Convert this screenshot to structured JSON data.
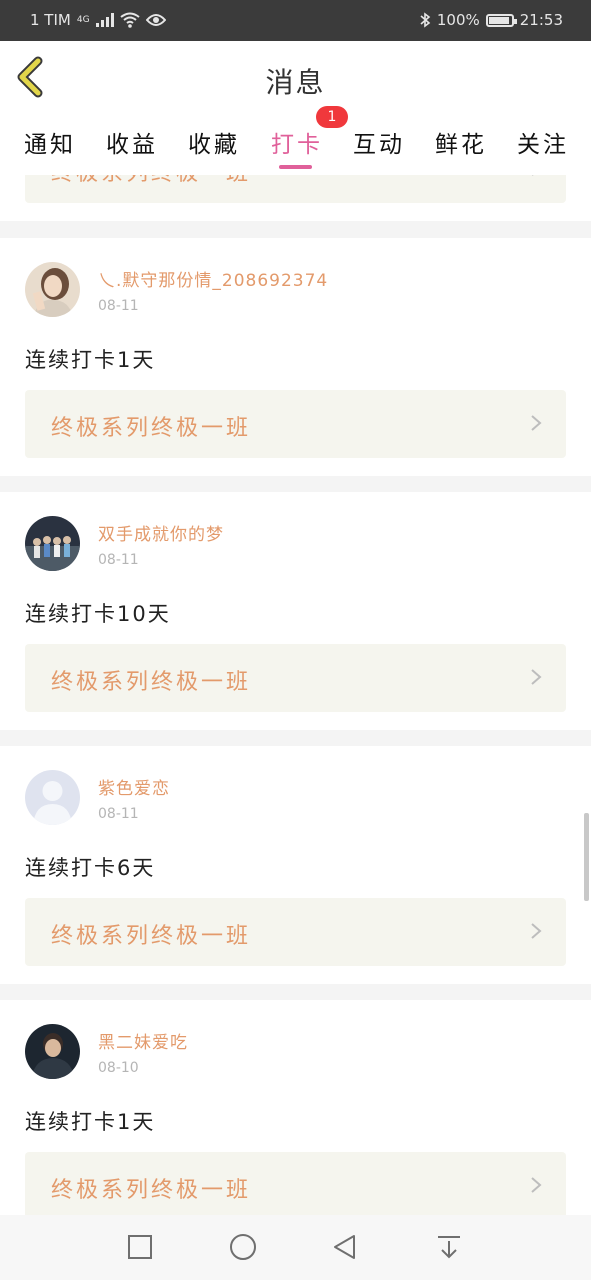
{
  "status_bar": {
    "carrier": "1 TIM",
    "network": "4G",
    "battery": "100%",
    "time": "21:53"
  },
  "header": {
    "title": "消息"
  },
  "tabs": {
    "items": [
      "通知",
      "收益",
      "收藏",
      "打卡",
      "互动",
      "鲜花",
      "关注"
    ],
    "active": "打卡",
    "badge": "1"
  },
  "feed": {
    "partial_course_label": "终极系列终极一班",
    "cards": [
      {
        "username": "乀.默守那份情_208692374",
        "date": "08-11",
        "content": "连续打卡1天",
        "course": "终极系列终极一班",
        "avatar": "girl-photo"
      },
      {
        "username": "双手成就你的梦",
        "date": "08-11",
        "content": "连续打卡10天",
        "course": "终极系列终极一班",
        "avatar": "group-photo"
      },
      {
        "username": "紫色爱恋",
        "date": "08-11",
        "content": "连续打卡6天",
        "course": "终极系列终极一班",
        "avatar": "default-user"
      },
      {
        "username": "黑二妹爱吃",
        "date": "08-10",
        "content": "连续打卡1天",
        "course": "终极系列终极一班",
        "avatar": "man-photo"
      }
    ]
  },
  "nav_bar": {
    "buttons": [
      "recent-apps",
      "home",
      "back",
      "notification-pull"
    ]
  },
  "colors": {
    "accent_pink": "#e0609a",
    "orange_text": "#e39a6b",
    "badge_red": "#f0383c",
    "back_arrow": "#e2d64a"
  }
}
